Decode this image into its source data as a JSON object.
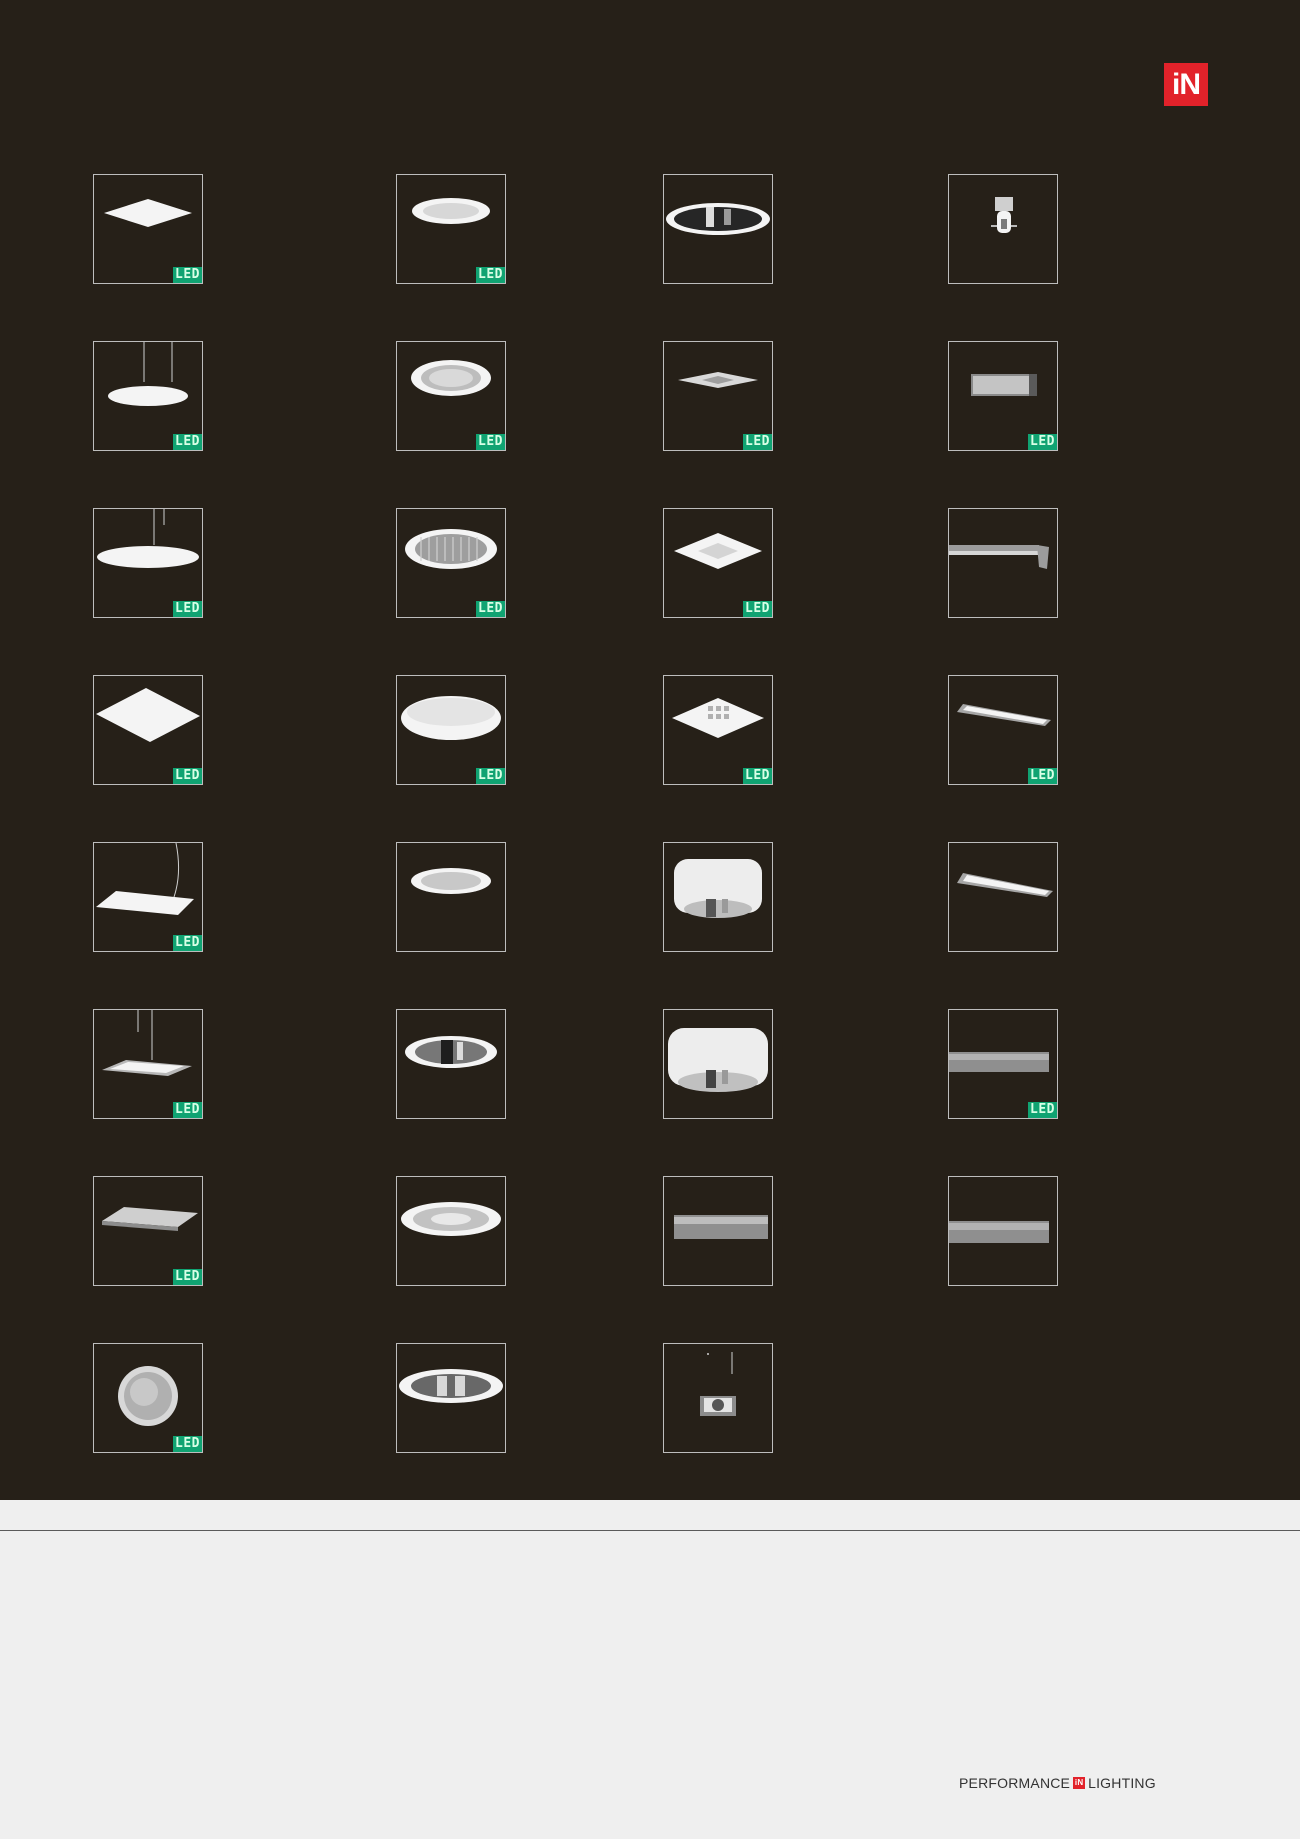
{
  "brand": {
    "logo_text": "iN",
    "accent_color": "#e2222a",
    "panel_color": "#262018"
  },
  "products": {
    "badge_label": "LED",
    "badge_color": "#10a372",
    "items": [
      {
        "icon": "square-panel-icon",
        "led": true
      },
      {
        "icon": "round-downlight-icon",
        "led": true
      },
      {
        "icon": "reflector-downlight-icon",
        "led": false
      },
      {
        "icon": "spotlight-icon",
        "led": false
      },
      {
        "icon": "round-pendant-small-icon",
        "led": true
      },
      {
        "icon": "round-downlight-deep-icon",
        "led": true
      },
      {
        "icon": "square-downlight-flat-icon",
        "led": true
      },
      {
        "icon": "rectangular-wall-light-icon",
        "led": true
      },
      {
        "icon": "round-pendant-large-icon",
        "led": true
      },
      {
        "icon": "grid-downlight-icon",
        "led": true
      },
      {
        "icon": "square-recessed-icon",
        "led": true
      },
      {
        "icon": "linear-wall-bracket-icon",
        "led": false
      },
      {
        "icon": "square-panel-large-icon",
        "led": true
      },
      {
        "icon": "dome-downlight-icon",
        "led": true
      },
      {
        "icon": "square-louver-icon",
        "led": true
      },
      {
        "icon": "linear-surface-icon",
        "led": true
      },
      {
        "icon": "square-pendant-icon",
        "led": true
      },
      {
        "icon": "slim-downlight-icon",
        "led": false
      },
      {
        "icon": "cylinder-surface-icon",
        "led": false
      },
      {
        "icon": "linear-surface-long-icon",
        "led": false
      },
      {
        "icon": "framed-pendant-icon",
        "led": true
      },
      {
        "icon": "chrome-downlight-icon",
        "led": false
      },
      {
        "icon": "cylinder-surface-large-icon",
        "led": false
      },
      {
        "icon": "linear-batten-icon",
        "led": true
      },
      {
        "icon": "square-surface-icon",
        "led": true
      },
      {
        "icon": "wide-downlight-icon",
        "led": false
      },
      {
        "icon": "linear-tube-icon",
        "led": false
      },
      {
        "icon": "linear-batten-plain-icon",
        "led": false
      },
      {
        "icon": "round-bulkhead-icon",
        "led": true
      },
      {
        "icon": "twin-reflector-downlight-icon",
        "led": false
      },
      {
        "icon": "suspended-spot-icon",
        "led": false
      }
    ]
  },
  "footer": {
    "left": "PERFORMANCE",
    "mark": "iN",
    "right": "LIGHTING"
  }
}
